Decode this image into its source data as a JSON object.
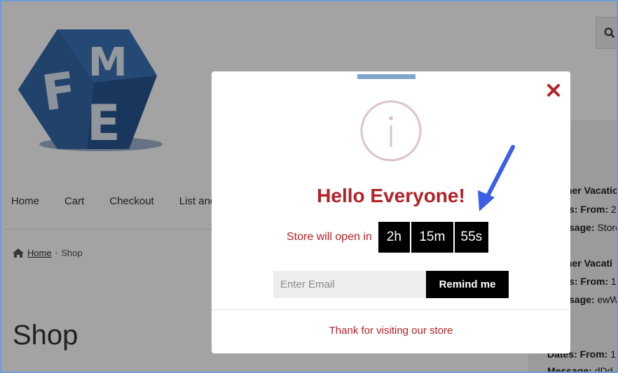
{
  "page": {
    "nav": [
      "Home",
      "Cart",
      "Checkout",
      "List and"
    ],
    "breadcrumb": {
      "home": "Home",
      "separator": "›",
      "current": "Shop"
    },
    "title": "Shop",
    "logo_letters": [
      "F",
      "M",
      "E"
    ],
    "sidebar": [
      {
        "label": "mer Vacatio",
        "value": ""
      },
      {
        "label": "s: From:",
        "value": " 2"
      },
      {
        "label": "sage:",
        "value": " Store"
      },
      {
        "label": "mer Vacati",
        "value": ""
      },
      {
        "label": "s: From:",
        "value": " 1"
      },
      {
        "label": "sage:",
        "value": " ewW"
      },
      {
        "label": "Dates: From:",
        "value": " 1"
      },
      {
        "label": "Message:",
        "value": " dDd"
      }
    ]
  },
  "modal": {
    "title": "Hello Everyone!",
    "countdown_label": "Store will open in",
    "countdown": {
      "hours": "2h",
      "minutes": "15m",
      "seconds": "55s"
    },
    "email_placeholder": "Enter Email",
    "remind_label": "Remind me",
    "footer": "Thank for visiting our store",
    "close_icon": "close-x-icon",
    "info_icon": "info-circle-icon"
  },
  "colors": {
    "accent_red": "#b22226",
    "arrow_blue": "#3b5ee6",
    "frame_blue": "#6f9bd6",
    "logo_blue": "#2e5f9f"
  }
}
